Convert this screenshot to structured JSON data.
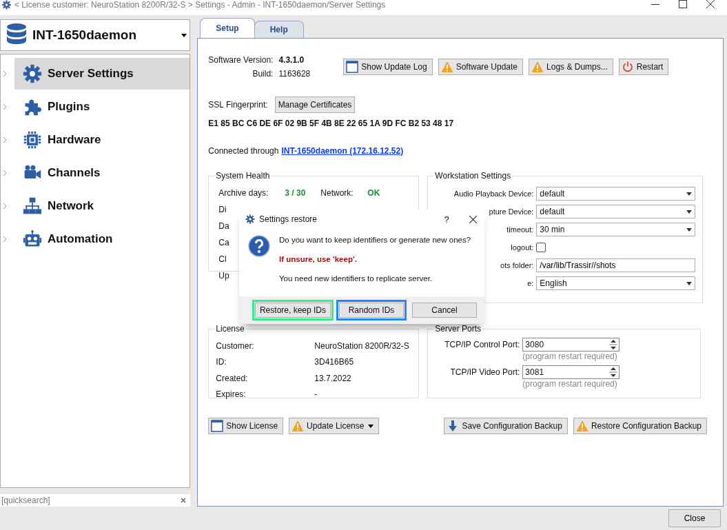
{
  "window": {
    "title": "< License customer: NeuroStation 8200R/32-S > Settings - Admin - INT-1650daemon/Server Settings"
  },
  "sidebar": {
    "server": "INT-1650daemon",
    "items": [
      {
        "label": "Server Settings",
        "selected": true
      },
      {
        "label": "Plugins",
        "selected": false
      },
      {
        "label": "Hardware",
        "selected": false
      },
      {
        "label": "Channels",
        "selected": false
      },
      {
        "label": "Network",
        "selected": false
      },
      {
        "label": "Automation",
        "selected": false
      }
    ],
    "quicksearch": {
      "placeholder": "[quicksearch]"
    }
  },
  "tabs": [
    {
      "label": "Setup",
      "selected": true
    },
    {
      "label": "Help",
      "selected": false
    }
  ],
  "setup": {
    "version_label": "Software Version:",
    "version": "4.3.1.0",
    "build_label": "Build:",
    "build": "1163628",
    "toolbar": [
      {
        "label": "Show Update Log",
        "kind": "window"
      },
      {
        "label": "Software Update",
        "kind": "warning"
      },
      {
        "label": "Logs & Dumps...",
        "kind": "warning"
      },
      {
        "label": "Restart",
        "kind": "power"
      }
    ],
    "ssl_label": "SSL Fingerprint:",
    "ssl_button": "Manage Certificates",
    "fingerprint": "E1 85 BC C6 DE 6F 02 9B 5F 4B 8E 22 65 1A 9D FC B2 53 48 17",
    "connected_label": "Connected through",
    "connected_link": "INT-1650daemon (172.16.12.52)",
    "system_health": {
      "title": "System Health",
      "archive_label": "Archive days:",
      "archive_value": "3 / 30",
      "network_label": "Network:",
      "network_value": "OK",
      "rows": [
        "Di",
        "Da",
        "Ca",
        "Cl",
        "Up"
      ]
    },
    "workstation": {
      "title": "Workstation Settings",
      "rows": [
        {
          "label": "Audio Playback Device:",
          "kind": "select",
          "value": "default"
        },
        {
          "label": "pture Device:",
          "kind": "select",
          "value": "default"
        },
        {
          "label": "timeout:",
          "kind": "select",
          "value": "30 min"
        },
        {
          "label": "logout:",
          "kind": "checkbox",
          "checked": false
        },
        {
          "label": "ots folder:",
          "kind": "text",
          "value": "/var/lib/Trassir//shots"
        },
        {
          "label": "e:",
          "kind": "select",
          "value": "English"
        }
      ]
    },
    "license": {
      "title": "License",
      "rows": [
        {
          "label": "Customer:",
          "value": "NeuroStation 8200R/32-S"
        },
        {
          "label": "ID:",
          "value": "3D416B65"
        },
        {
          "label": "Created:",
          "value": "13.7.2022"
        },
        {
          "label": "Expires:",
          "value": "-"
        }
      ]
    },
    "server_ports": {
      "title": "Server Ports",
      "rows": [
        {
          "label": "TCP/IP Control Port:",
          "value": "3080",
          "note": "(program restart required)"
        },
        {
          "label": "TCP/IP Video Port:",
          "value": "3081",
          "note": "(program restart required)"
        }
      ]
    },
    "bottom_buttons": [
      {
        "label": "Show License",
        "kind": "window",
        "dropdown": false
      },
      {
        "label": "Update License",
        "kind": "warning",
        "dropdown": true
      },
      {
        "label": "Save Configuration Backup",
        "kind": "download",
        "dropdown": false
      },
      {
        "label": "Restore Configuration Backup",
        "kind": "warning",
        "dropdown": false
      }
    ]
  },
  "dialog": {
    "title": "Settings restore",
    "help": "?",
    "question": "Do you want to keep identifiers or generate new ones?",
    "warning": "If unsure, use 'keep'.",
    "info": "You need new identifiers to replicate server.",
    "buttons": [
      {
        "label": "Restore, keep IDs",
        "color": "#33ee88"
      },
      {
        "label": "Random IDs",
        "color": "#1e88ff"
      },
      {
        "label": "Cancel"
      }
    ]
  },
  "close_button": "Close"
}
